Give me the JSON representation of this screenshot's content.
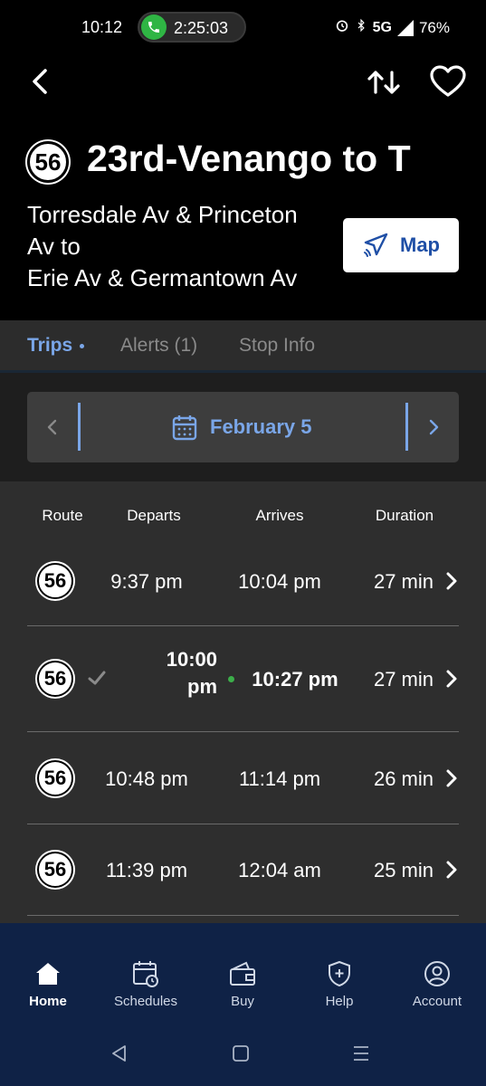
{
  "status_bar": {
    "time": "10:12",
    "call_timer": "2:25:03",
    "network": "5G",
    "battery": "76%",
    "call_color": "#2fb544"
  },
  "header": {
    "route_number": "56",
    "title": "23rd-Venango to T",
    "subtitle_line1": "Torresdale Av & Princeton",
    "subtitle_line2": "Av to",
    "subtitle_line3": "Erie Av & Germantown Av",
    "map_label": "Map",
    "icons": {
      "back": "chevron-left-icon",
      "swap": "swap-direction-icon",
      "favorite": "heart-icon",
      "map": "navigation-arrow-icon"
    }
  },
  "tabs": [
    {
      "label": "Trips",
      "active": true
    },
    {
      "label": "Alerts (1)",
      "active": false
    },
    {
      "label": "Stop Info",
      "active": false
    }
  ],
  "date_selector": {
    "date": "February 5",
    "accent": "#7aa6e8"
  },
  "table": {
    "headers": [
      "Route",
      "Departs",
      "Arrives",
      "Duration"
    ],
    "rows": [
      {
        "route": "56",
        "departs": "9:37 pm",
        "arrives": "10:04 pm",
        "duration": "27 min",
        "highlight": false
      },
      {
        "route": "56",
        "departs_line1": "10:00",
        "departs_line2": "pm",
        "arrives": "10:27 pm",
        "duration": "27 min",
        "highlight": true
      },
      {
        "route": "56",
        "departs": "10:48 pm",
        "arrives": "11:14 pm",
        "duration": "26 min",
        "highlight": false
      },
      {
        "route": "56",
        "departs": "11:39 pm",
        "arrives": "12:04 am",
        "duration": "25 min",
        "highlight": false
      }
    ]
  },
  "bottom_nav": [
    {
      "label": "Home",
      "icon": "home-icon",
      "active": true
    },
    {
      "label": "Schedules",
      "icon": "calendar-clock-icon",
      "active": false
    },
    {
      "label": "Buy",
      "icon": "wallet-icon",
      "active": false
    },
    {
      "label": "Help",
      "icon": "shield-plus-icon",
      "active": false
    },
    {
      "label": "Account",
      "icon": "account-icon",
      "active": false
    }
  ],
  "colors": {
    "nav_bg": "#0f2246",
    "map_text": "#1f4fa6",
    "live_dot": "#3cae4a"
  }
}
